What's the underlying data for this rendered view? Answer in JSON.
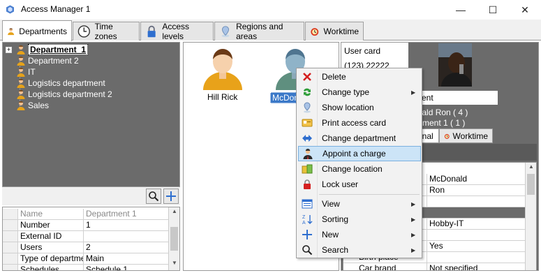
{
  "window": {
    "title": "Access Manager 1"
  },
  "tabs": [
    {
      "label": "Departments"
    },
    {
      "label": "Time zones"
    },
    {
      "label": "Access levels"
    },
    {
      "label": "Regions and areas"
    },
    {
      "label": "Worktime"
    }
  ],
  "tree": {
    "root": "Department_1",
    "items": [
      "Department 2",
      "IT",
      "Logistics department",
      "Logistics department 2",
      "Sales"
    ]
  },
  "properties": [
    {
      "key": "Name",
      "value": "Department 1"
    },
    {
      "key": "Number",
      "value": "1"
    },
    {
      "key": "External ID",
      "value": ""
    },
    {
      "key": "Users",
      "value": "2"
    },
    {
      "key": "Type of departmer",
      "value": "Main"
    },
    {
      "key": "Schedules",
      "value": "Schedule 1"
    }
  ],
  "avatars": [
    {
      "name": "Hill Rick"
    },
    {
      "name": "McDonald"
    }
  ],
  "user_card": {
    "label": "User card",
    "number": "(123) 22222",
    "dept_field": "ment",
    "owner_line": "onald Ron ( 4 )",
    "dept_line": "artment 1 ( 1 )",
    "tab_partial": "onal",
    "tab_worktime": "Worktime"
  },
  "details": [
    {
      "key": "",
      "value": "McDonald"
    },
    {
      "key": "",
      "value": "Ron"
    },
    {
      "key": "",
      "value": ""
    },
    {
      "key": "",
      "value": "",
      "section": true
    },
    {
      "key": "o",
      "value": "Hobby-IT"
    },
    {
      "key": "k",
      "value": ""
    },
    {
      "key": "",
      "value": "Yes"
    },
    {
      "key": "Birth place",
      "value": ""
    },
    {
      "key": "Car brand",
      "value": "Not specified"
    }
  ],
  "context_menu": [
    {
      "label": "Delete",
      "icon": "delete-icon",
      "submenu": false
    },
    {
      "label": "Change type",
      "icon": "change-type-icon",
      "submenu": true
    },
    {
      "label": "Show location",
      "icon": "location-pin-icon",
      "submenu": false
    },
    {
      "label": "Print access card",
      "icon": "print-card-icon",
      "submenu": false
    },
    {
      "label": "Change department",
      "icon": "swap-arrows-icon",
      "submenu": false
    },
    {
      "label": "Appoint a charge",
      "icon": "charge-person-icon",
      "submenu": false,
      "highlighted": true
    },
    {
      "label": "Change location",
      "icon": "change-location-icon",
      "submenu": false
    },
    {
      "label": "Lock user",
      "icon": "lock-icon",
      "submenu": false
    },
    {
      "label": "View",
      "icon": "view-icon",
      "submenu": true
    },
    {
      "label": "Sorting",
      "icon": "sort-icon",
      "submenu": true
    },
    {
      "label": "New",
      "icon": "plus-icon",
      "submenu": true
    },
    {
      "label": "Search",
      "icon": "search-icon",
      "submenu": true
    }
  ],
  "colors": {
    "accent": "#3a78c8",
    "menu_highlight": "#cce4f7",
    "panel_grey": "#6b6b6b"
  }
}
